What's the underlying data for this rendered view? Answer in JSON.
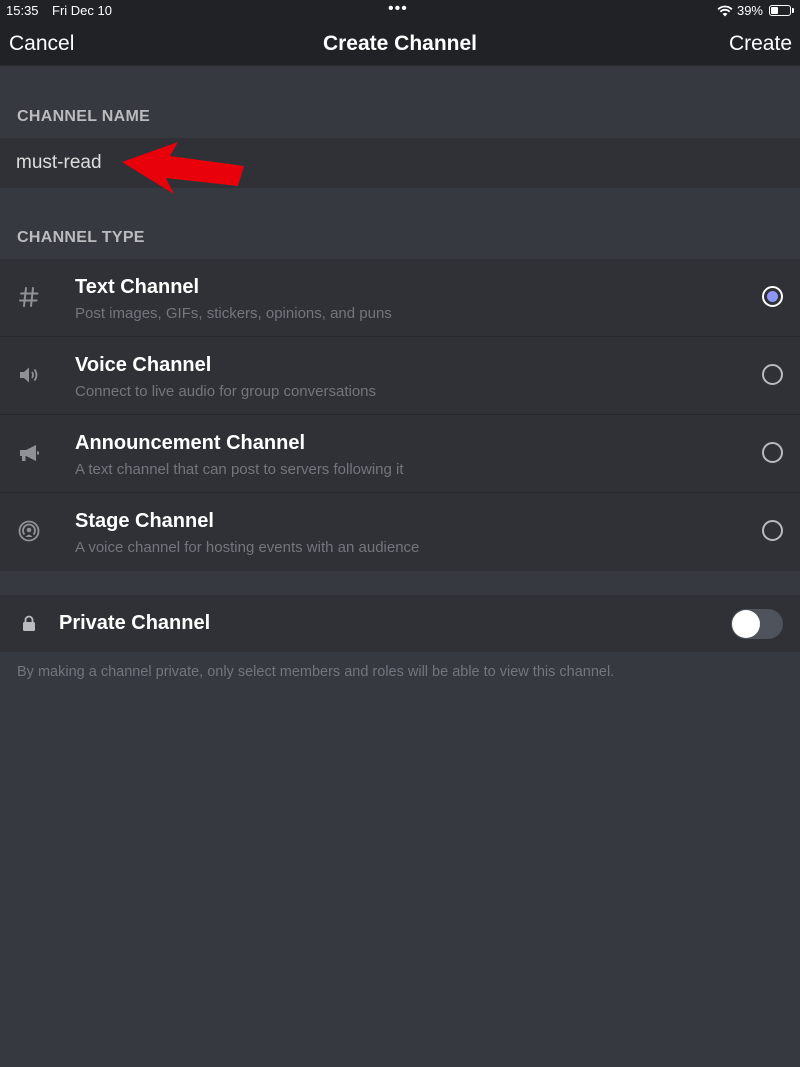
{
  "status_bar": {
    "time": "15:35",
    "date": "Fri Dec 10",
    "dots": "•••",
    "battery_percent": "39%",
    "battery_level": 0.39
  },
  "nav": {
    "cancel_label": "Cancel",
    "title": "Create Channel",
    "create_label": "Create"
  },
  "channel_name": {
    "header": "CHANNEL NAME",
    "value": "must-read"
  },
  "channel_type": {
    "header": "CHANNEL TYPE",
    "selected": "text",
    "items": [
      {
        "icon": "hash-icon",
        "title": "Text Channel",
        "desc": "Post images, GIFs, stickers, opinions, and puns",
        "checked": true
      },
      {
        "icon": "speaker-icon",
        "title": "Voice Channel",
        "desc": "Connect to live audio for group conversations",
        "checked": false
      },
      {
        "icon": "megaphone-icon",
        "title": "Announcement Channel",
        "desc": "A text channel that can post to servers following it",
        "checked": false
      },
      {
        "icon": "stage-icon",
        "title": "Stage Channel",
        "desc": "A voice channel for hosting events with an audience",
        "checked": false
      }
    ]
  },
  "private": {
    "label": "Private Channel",
    "enabled": false,
    "help": "By making a channel private, only select members and roles will be able to view this channel."
  },
  "colors": {
    "background": "#36393f",
    "panel": "#2f3136",
    "bar": "#202225",
    "accent": "#8c96f5",
    "annotation_arrow": "#e8000b"
  }
}
